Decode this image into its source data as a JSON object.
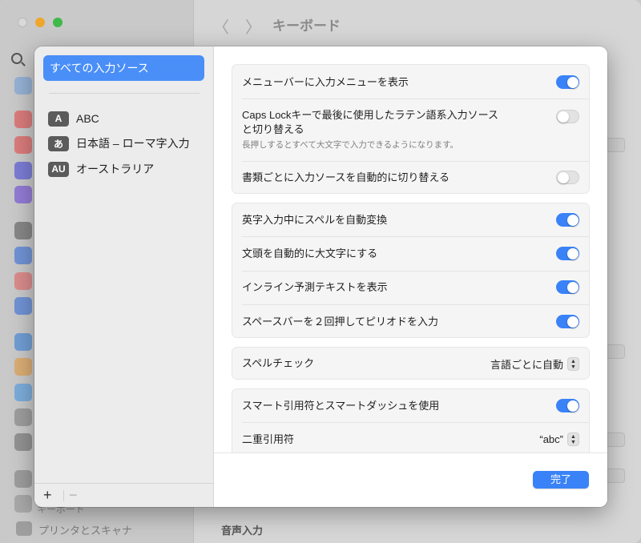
{
  "background": {
    "window_title": "キーボード",
    "nav_back": "〈",
    "nav_forward": "〉",
    "printer_label": "プリンタとスキャナ",
    "partial_label": "キーボード",
    "voice_input_label": "音声入力"
  },
  "sidebar": {
    "all_sources_label": "すべての入力ソース",
    "sources": [
      {
        "badge": "A",
        "label": "ABC"
      },
      {
        "badge": "あ",
        "label": "日本語 – ローマ字入力"
      },
      {
        "badge": "AU",
        "label": "オーストラリア"
      }
    ],
    "add_label": "+",
    "remove_label": "−"
  },
  "settings": {
    "show_input_menu": {
      "label": "メニューバーに入力メニューを表示",
      "on": true
    },
    "caps_lock": {
      "label_line1": "Caps Lockキーで最後に使用したラテン語系入力ソース",
      "label_line2": "と切り替える",
      "sublabel": "長押しするとすべて大文字で入力できるようになります。",
      "on": false
    },
    "auto_switch": {
      "label": "書類ごとに入力ソースを自動的に切り替える",
      "on": false
    },
    "auto_correct": {
      "label": "英字入力中にスペルを自動変換",
      "on": true
    },
    "auto_capitalize": {
      "label": "文頭を自動的に大文字にする",
      "on": true
    },
    "inline_predictive": {
      "label": "インライン予測テキストを表示",
      "on": true
    },
    "double_space_period": {
      "label": "スペースバーを２回押してピリオドを入力",
      "on": true
    },
    "spelling": {
      "label": "スペルチェック",
      "value": "言語ごとに自動"
    },
    "smart_quotes": {
      "label": "スマート引用符とスマートダッシュを使用",
      "on": true
    },
    "double_quotes": {
      "label": "二重引用符",
      "value": "“abc”"
    }
  },
  "footer": {
    "done_label": "完了"
  },
  "colors": {
    "accent": "#3a82f7",
    "selection": "#4a8ef8"
  }
}
